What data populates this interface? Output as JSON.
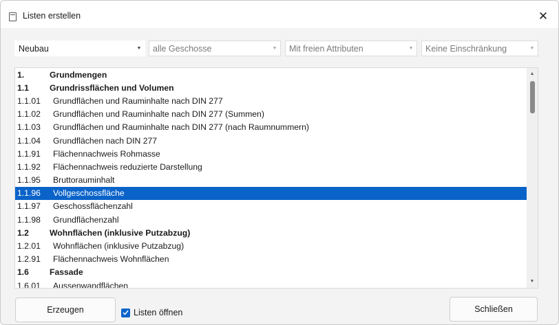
{
  "window": {
    "title": "Listen erstellen",
    "close_glyph": "✕"
  },
  "filters": [
    {
      "value": "Neubau",
      "enabled": true
    },
    {
      "value": "alle Geschosse",
      "enabled": false
    },
    {
      "value": "Mit freien Attributen",
      "enabled": false
    },
    {
      "value": "Keine Einschränkung",
      "enabled": false
    }
  ],
  "list": {
    "items": [
      {
        "num": "1.",
        "label": "Grundmengen",
        "bold": true
      },
      {
        "num": "1.1",
        "label": "Grundrissflächen und Volumen",
        "bold": true
      },
      {
        "num": "1.1.01",
        "label": "Grundflächen und Rauminhalte nach DIN 277"
      },
      {
        "num": "1.1.02",
        "label": "Grundflächen und Rauminhalte nach DIN 277 (Summen)"
      },
      {
        "num": "1.1.03",
        "label": "Grundflächen und Rauminhalte nach DIN 277 (nach Raumnummern)"
      },
      {
        "num": "1.1.04",
        "label": "Grundflächen nach DIN 277"
      },
      {
        "num": "1.1.91",
        "label": "Flächennachweis Rohmasse"
      },
      {
        "num": "1.1.92",
        "label": "Flächennachweis reduzierte Darstellung"
      },
      {
        "num": "1.1.95",
        "label": "Bruttorauminhalt"
      },
      {
        "num": "1.1.96",
        "label": "Vollgeschossfläche",
        "selected": true
      },
      {
        "num": "1.1.97",
        "label": "Geschossflächenzahl"
      },
      {
        "num": "1.1.98",
        "label": "Grundflächenzahl"
      },
      {
        "num": "1.2",
        "label": "Wohnflächen (inklusive Putzabzug)",
        "bold": true
      },
      {
        "num": "1.2.01",
        "label": "Wohnflächen (inklusive Putzabzug)"
      },
      {
        "num": "1.2.91",
        "label": "Flächennachweis Wohnflächen"
      },
      {
        "num": "1.6",
        "label": "Fassade",
        "bold": true
      },
      {
        "num": "1.6.01",
        "label": "Aussenwandflächen"
      }
    ],
    "scroll_position": 0.06
  },
  "footer": {
    "generate_label": "Erzeugen",
    "open_lists_label": "Listen öffnen",
    "open_lists_checked": true,
    "close_label": "Schließen"
  },
  "colors": {
    "accent": "#0a63c9"
  },
  "icons": {
    "title": "list-document-icon",
    "close": "close-icon",
    "dropdown": "chevron-down-icon",
    "check": "checkmark-icon"
  }
}
